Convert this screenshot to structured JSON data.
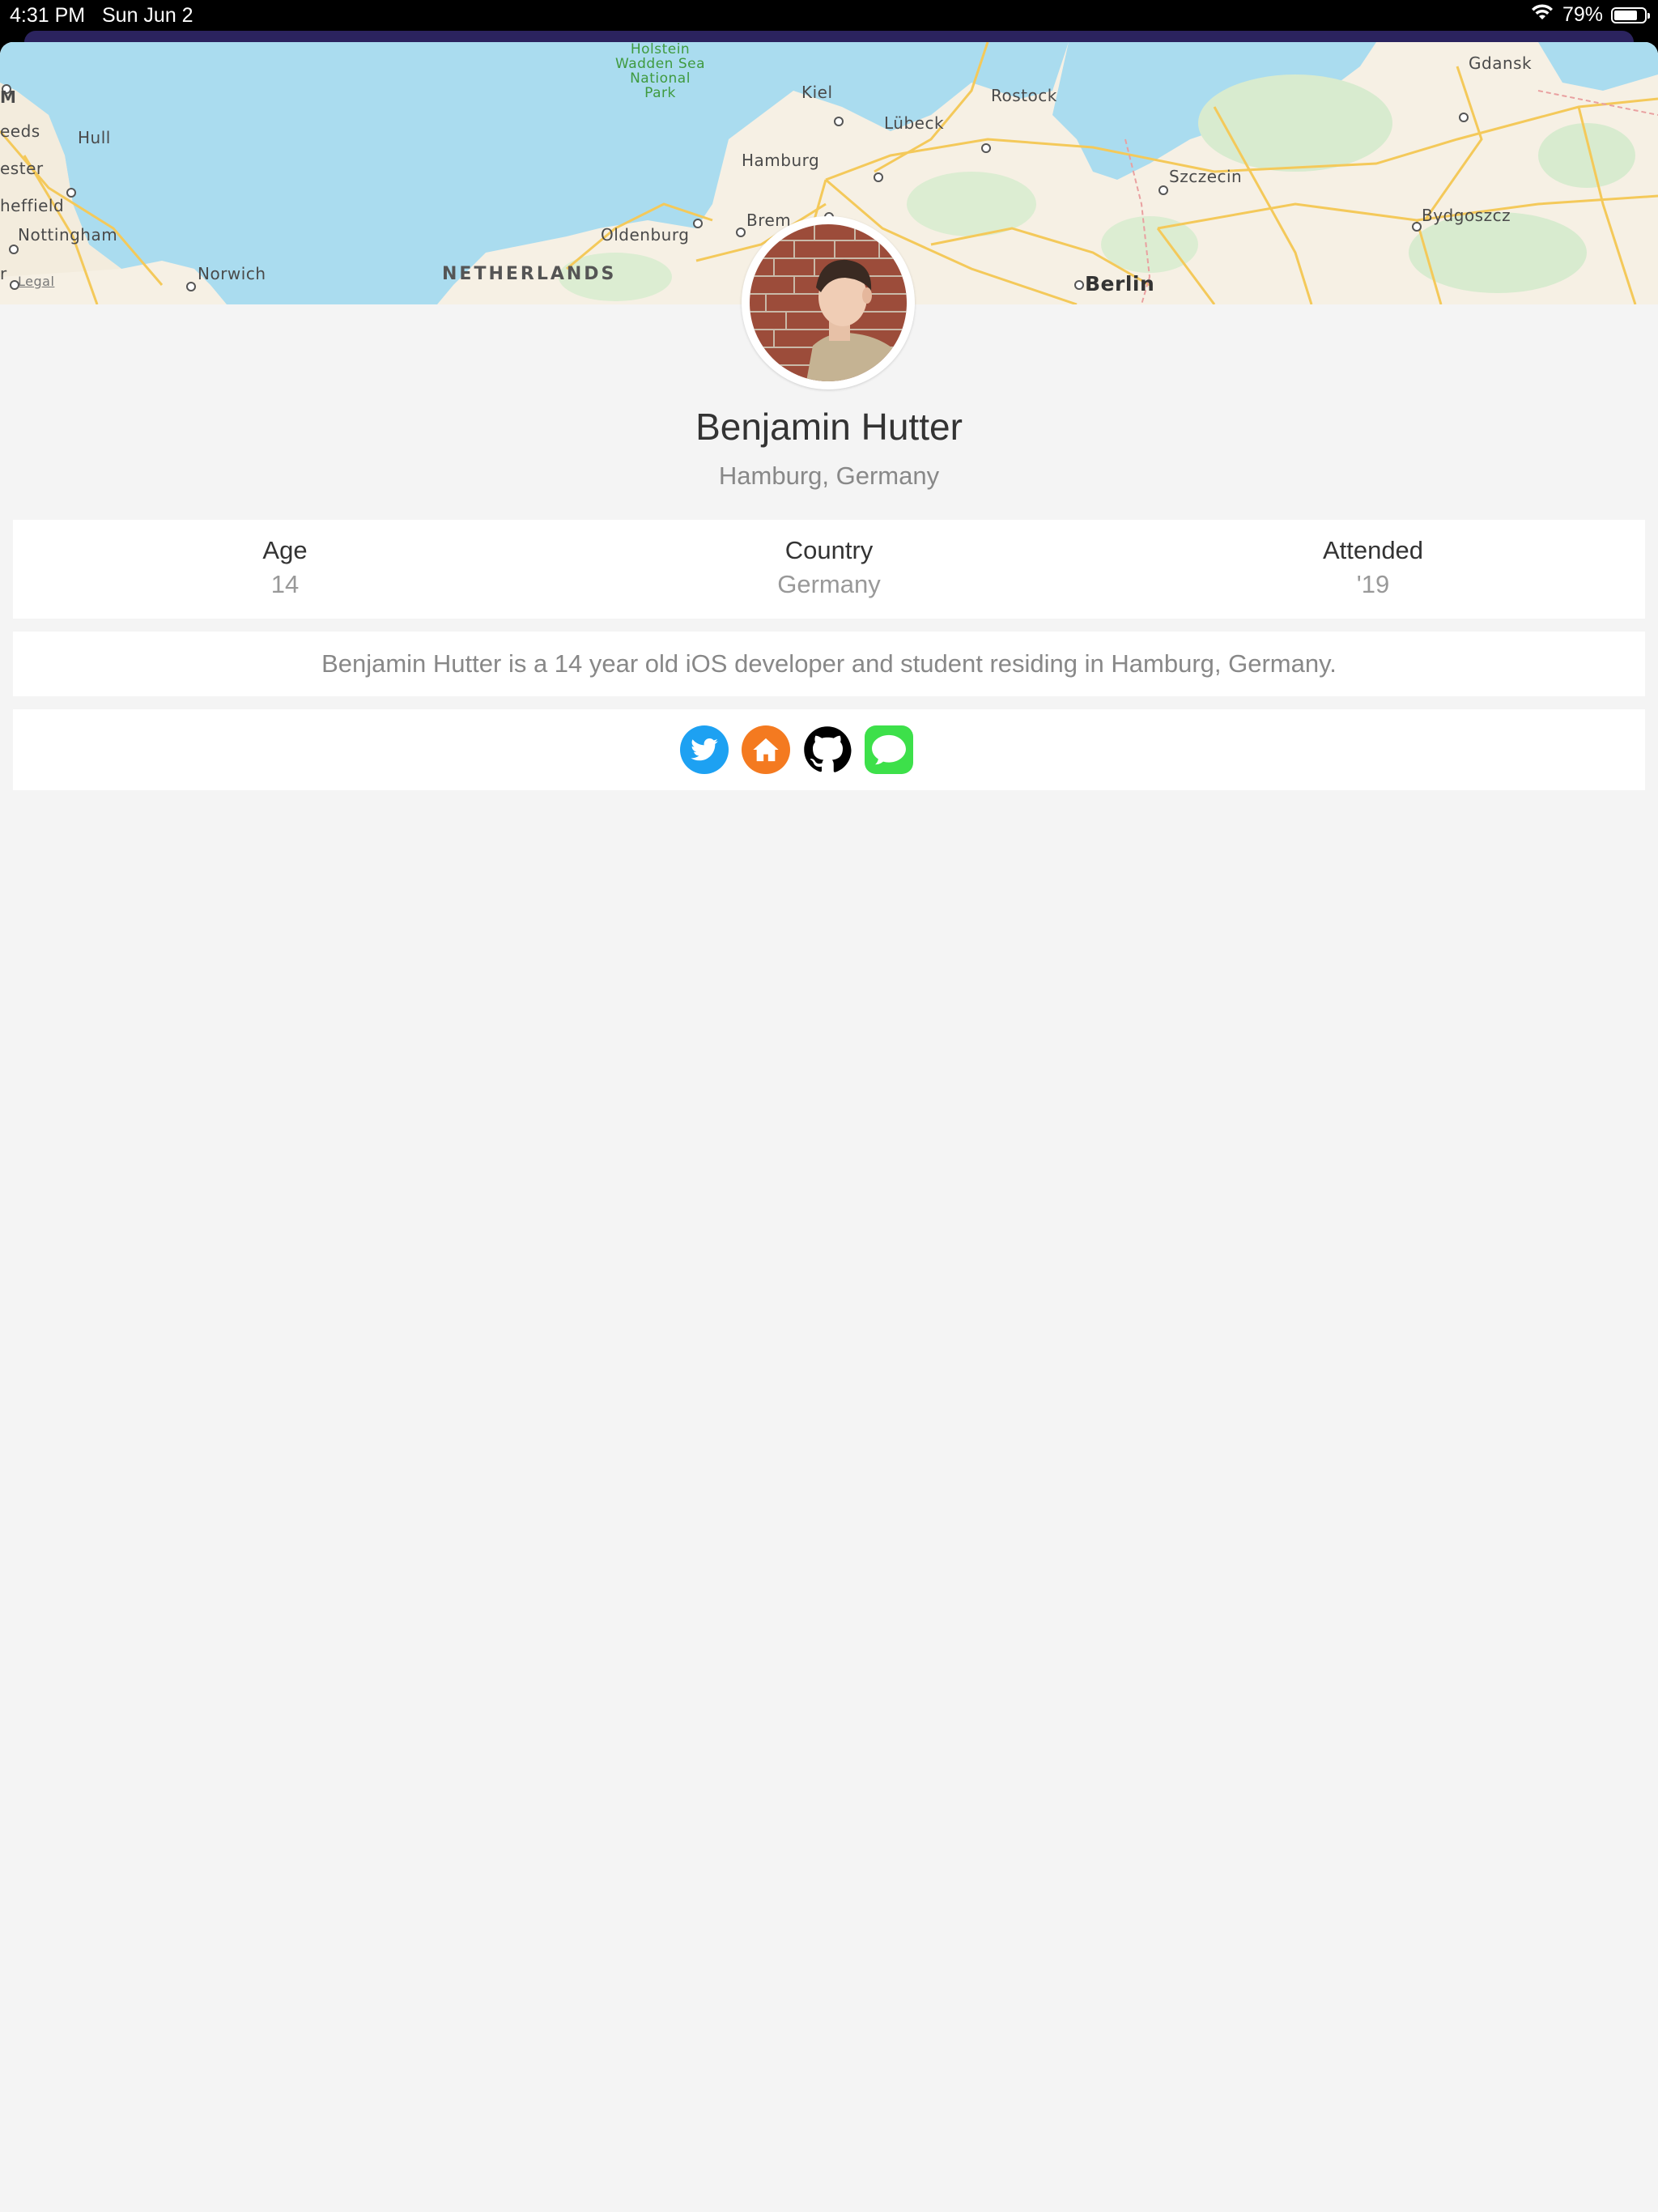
{
  "status_bar": {
    "time": "4:31 PM",
    "date": "Sun Jun 2",
    "battery": "79%",
    "battery_level": 0.79
  },
  "map": {
    "labels": {
      "holstein": "Holstein",
      "wadden": "Wadden Sea",
      "national": "National",
      "park": "Park",
      "kiel": "Kiel",
      "rostock": "Rostock",
      "gdansk": "Gdansk",
      "m": "M",
      "leeds": "eeds",
      "hull": "Hull",
      "ester": "ester",
      "sheffield": "heffield",
      "nottingham": "Nottingham",
      "norwich": "Norwich",
      "r": "r",
      "legal": "Legal",
      "netherlands": "NETHERLANDS",
      "oldenburg": "Oldenburg",
      "bremen": "Brem",
      "hamburg": "Hamburg",
      "lubeck": "Lübeck",
      "szczecin": "Szczecin",
      "bydgoszcz": "Bydgoszcz",
      "berlin": "Berlin"
    }
  },
  "profile": {
    "name": "Benjamin Hutter",
    "location": "Hamburg, Germany",
    "stats": [
      {
        "label": "Age",
        "value": "14"
      },
      {
        "label": "Country",
        "value": "Germany"
      },
      {
        "label": "Attended",
        "value": "'19"
      }
    ],
    "bio": "Benjamin Hutter is a 14 year old iOS developer and student residing in Hamburg, Germany.",
    "links": [
      {
        "icon": "twitter-icon",
        "color": "#1da1f2"
      },
      {
        "icon": "home-icon",
        "color": "#f47a20"
      },
      {
        "icon": "github-icon",
        "color": "#000000"
      },
      {
        "icon": "messages-icon",
        "color": "#3de04a"
      }
    ]
  }
}
